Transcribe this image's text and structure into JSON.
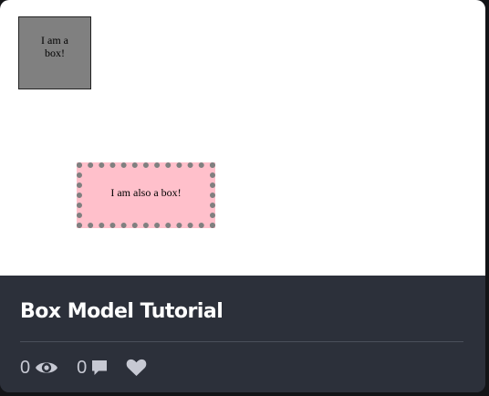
{
  "preview": {
    "box1_text": "I am a box!",
    "box2_text": "I am also a box!",
    "colors": {
      "box1_background": "#808080",
      "box2_background": "#ffc0cb",
      "box2_border": "#808080"
    }
  },
  "card": {
    "title": "Box Model Tutorial",
    "views_count": "0",
    "comments_count": "0",
    "icons": {
      "views": "eye-icon",
      "comments": "comment-icon",
      "likes": "heart-icon"
    }
  }
}
